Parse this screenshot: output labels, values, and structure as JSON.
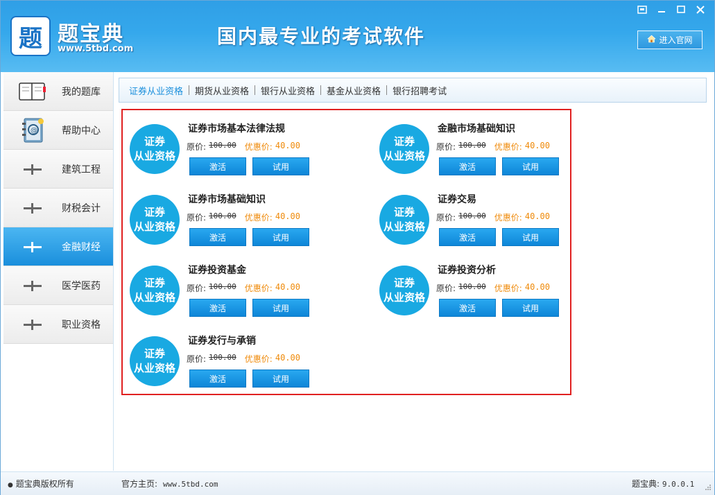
{
  "header": {
    "logo_char": "题",
    "app_name": "题宝典",
    "url": "www.5tbd.com",
    "slogan": "国内最专业的考试软件",
    "official_site_label": "进入官网",
    "window_controls": [
      "restore-icon",
      "minimize-icon",
      "maximize-icon",
      "close-icon"
    ]
  },
  "sidebar": {
    "items": [
      {
        "label": "我的题库",
        "icon": "book-icon"
      },
      {
        "label": "帮助中心",
        "icon": "address-book-icon"
      },
      {
        "label": "建筑工程",
        "icon": "plus-icon"
      },
      {
        "label": "财税会计",
        "icon": "plus-icon"
      },
      {
        "label": "金融财经",
        "icon": "plus-icon",
        "active": true
      },
      {
        "label": "医学医药",
        "icon": "plus-icon"
      },
      {
        "label": "职业资格",
        "icon": "plus-icon"
      }
    ]
  },
  "tabs": [
    "证券从业资格",
    "期货从业资格",
    "银行从业资格",
    "基金从业资格",
    "银行招聘考试"
  ],
  "products": {
    "badge_line1": "证券",
    "badge_line2": "从业资格",
    "orig_label": "原价:",
    "discount_label": "优惠价:",
    "activate_label": "激活",
    "trial_label": "试用",
    "items": [
      {
        "title": "证券市场基本法律法规",
        "orig_price": "100.00",
        "discount_price": "40.00"
      },
      {
        "title": "金融市场基础知识",
        "orig_price": "100.00",
        "discount_price": "40.00"
      },
      {
        "title": "证券市场基础知识",
        "orig_price": "100.00",
        "discount_price": "40.00"
      },
      {
        "title": "证券交易",
        "orig_price": "100.00",
        "discount_price": "40.00"
      },
      {
        "title": "证券投资基金",
        "orig_price": "100.00",
        "discount_price": "40.00"
      },
      {
        "title": "证券投资分析",
        "orig_price": "100.00",
        "discount_price": "40.00"
      },
      {
        "title": "证券发行与承销",
        "orig_price": "100.00",
        "discount_price": "40.00"
      }
    ]
  },
  "status": {
    "copyright": "题宝典版权所有",
    "homepage_label": "官方主页:",
    "homepage_url": "www.5tbd.com",
    "version_label": "题宝典:",
    "version": "9.0.0.1"
  },
  "colors": {
    "header_blue": "#35a8ec",
    "badge_blue": "#19a9e2",
    "discount_orange": "#ef8a0a",
    "highlight_red": "#e02020"
  }
}
